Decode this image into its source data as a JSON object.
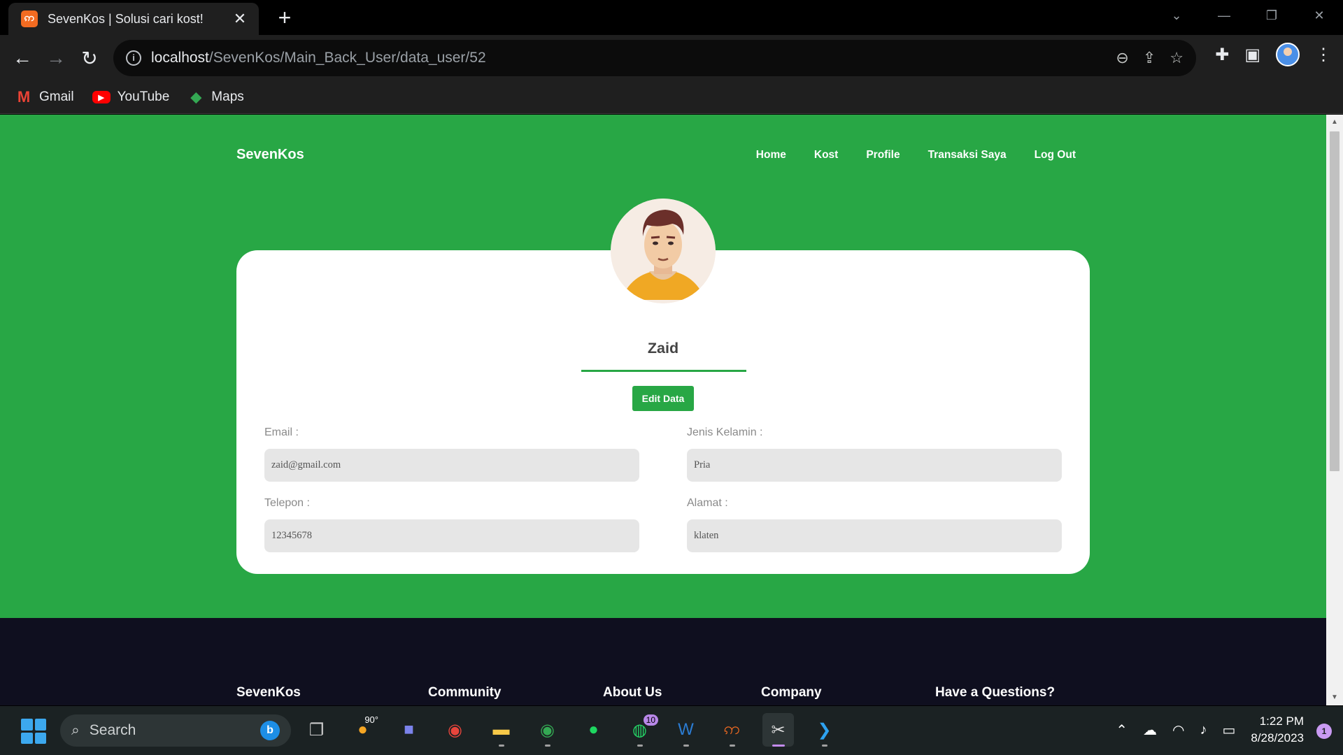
{
  "browser": {
    "tab_title": "SevenKos | Solusi cari kost!",
    "url_host": "localhost",
    "url_path": "/SevenKos/Main_Back_User/data_user/52",
    "bookmarks": [
      {
        "label": "Gmail",
        "icon": "gmail-icon"
      },
      {
        "label": "YouTube",
        "icon": "youtube-icon"
      },
      {
        "label": "Maps",
        "icon": "maps-icon"
      }
    ]
  },
  "site": {
    "brand": "SevenKos",
    "nav": [
      "Home",
      "Kost",
      "Profile",
      "Transaksi Saya",
      "Log Out"
    ],
    "accent_color": "#28a745",
    "footer_bg": "#0f0f1f"
  },
  "profile": {
    "name": "Zaid",
    "edit_label": "Edit Data",
    "fields": {
      "email_label": "Email :",
      "email_value": "zaid@gmail.com",
      "gender_label": "Jenis Kelamin :",
      "gender_value": "Pria",
      "phone_label": "Telepon :",
      "phone_value": "12345678",
      "address_label": "Alamat :",
      "address_value": "klaten"
    }
  },
  "footer": {
    "columns": [
      "SevenKos",
      "Community",
      "About Us",
      "Company",
      "Have a Questions?"
    ]
  },
  "taskbar": {
    "search_placeholder": "Search",
    "weather_temp": "90°",
    "whatsapp_badge": "10",
    "time": "1:22 PM",
    "date": "8/28/2023",
    "notification_count": "1"
  }
}
